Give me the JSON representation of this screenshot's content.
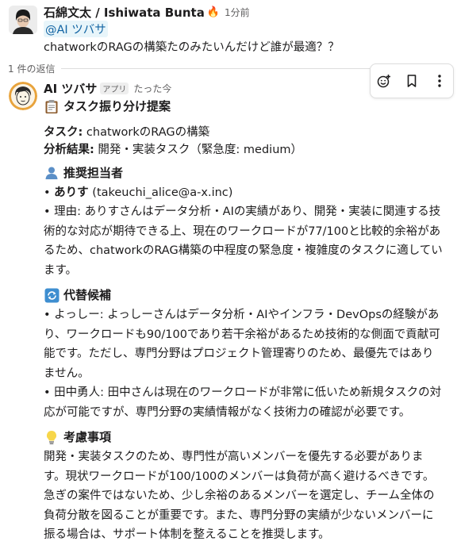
{
  "parent": {
    "author": "石綿文太 / Ishiwata Bunta",
    "status_emoji": "🔥",
    "time": "1分前",
    "mention": "@AI ツバサ",
    "text": "chatworkのRAGの構築たのみたいんだけど誰が最適？？"
  },
  "thread": {
    "reply_count": "1 件の返信"
  },
  "reply": {
    "author": "AI ツバサ",
    "badge": "アプリ",
    "time": "たった今",
    "title": "タスク振り分け提案",
    "task_label": "タスク:",
    "task_value": "chatworkのRAGの構築",
    "analysis_label": "分析結果:",
    "analysis_value": "開発・実装タスク（緊急度: medium）",
    "recommended_heading": "推奨担当者",
    "recommended_name": "ありす",
    "recommended_email": "(takeuchi_alice@a-x.inc)",
    "recommended_reason_lines": [
      "• 理由: ありすさんはデータ分析・AIの実績があり、開発・実装に関連する技",
      "術的な対応が期待できる上、現在のワークロードが77/100と比較的余裕があ",
      "るため、chatworkのRAG構築の中程度の緊急度・複雑度のタスクに適してい",
      "ます。"
    ],
    "alt_heading": "代替候補",
    "alt1_lines": [
      "• よっしー: よっしーさんはデータ分析・AIやインフラ・DevOpsの経験があ",
      "り、ワークロードも90/100であり若干余裕があるため技術的な側面で貢献可",
      "能です。ただし、専門分野はプロジェクト管理寄りのため、最優先ではあり",
      "ません。"
    ],
    "alt2_lines": [
      "• 田中勇人: 田中さんは現在のワークロードが非常に低いため新規タスクの対",
      "応が可能ですが、専門分野の実績情報がなく技術力の確認が必要です。"
    ],
    "consider_heading": "考慮事項",
    "consider_lines": [
      "開発・実装タスクのため、専門性が高いメンバーを優先する必要がありま",
      "す。現状ワークロードが100/100のメンバーは負荷が高く避けるべきです。",
      "急ぎの案件ではないため、少し余裕のあるメンバーを選定し、チーム全体の",
      "負荷分散を図ることが重要です。また、専門分野の実績が少ないメンバーに",
      "振る場合は、サポート体制を整えることを推奨します。"
    ]
  },
  "toolbar": {
    "icons": [
      "add-reaction-icon",
      "bookmark-icon",
      "more-actions-icon"
    ]
  },
  "colors": {
    "mention_bg": "#e8f5fa",
    "mention_text": "#1264a3",
    "avatar_ai_bg": "#e8a33c"
  }
}
